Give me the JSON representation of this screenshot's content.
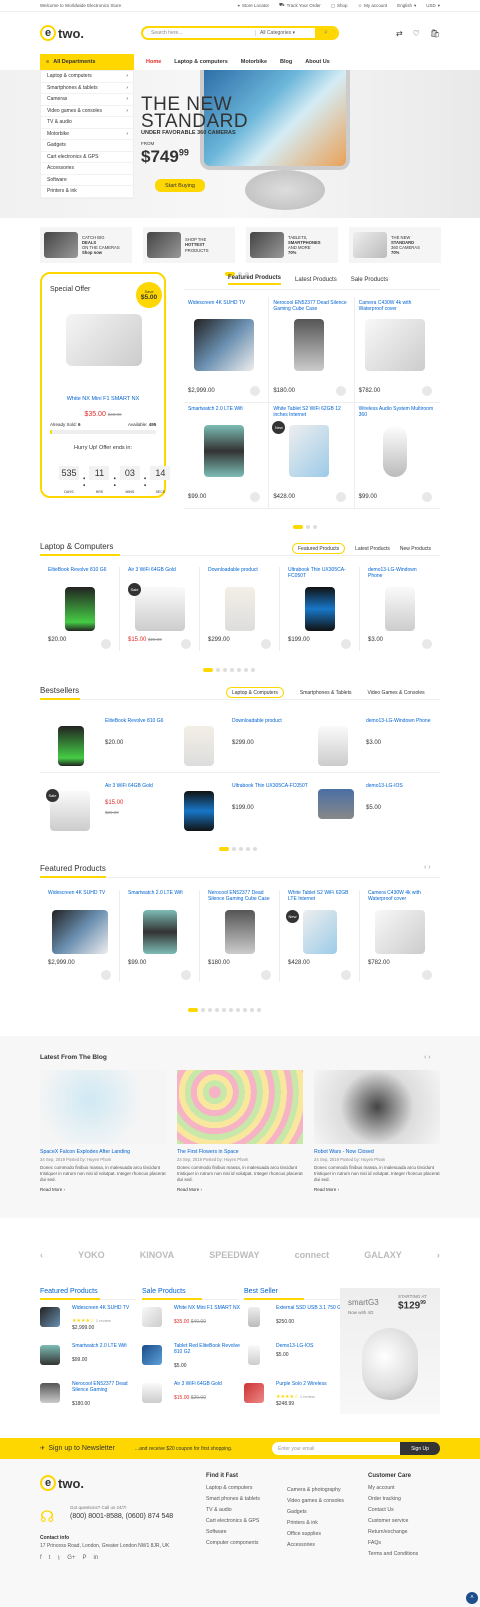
{
  "topbar": {
    "welcome": "Welcome to Worldwide Electronics Store",
    "links": [
      "Store Locator",
      "Track Your Order",
      "Shop",
      "My account"
    ],
    "lang": "English",
    "cur": "USD"
  },
  "header": {
    "logo": "two.",
    "search_placeholder": "Search here...",
    "search_cat": "All Categories"
  },
  "nav": {
    "dept": "All Departments",
    "links": [
      "Home",
      "Laptop & computers",
      "Motorbike",
      "Blog",
      "About Us"
    ]
  },
  "departments": [
    "Laptop & computers",
    "Smartphones & tablets",
    "Cameras",
    "Video games & consoles",
    "TV & audio",
    "Motorbike",
    "Gadgets",
    "Cart electronics & GPS",
    "Accessories",
    "Software",
    "Printers & ink"
  ],
  "hero": {
    "title1": "THE NEW",
    "title2": "STANDARD",
    "sub": "UNDER FAVORABLE 360 CAMERAS",
    "from": "FROM",
    "price": "$749",
    "cents": "99",
    "cta": "Start Buying"
  },
  "promos": [
    {
      "l1": "CATCH BIG",
      "l2": "DEALS",
      "l3": "ON THE CAMERAS",
      "shop": "Shop now"
    },
    {
      "l1": "SHOP THE",
      "l2": "HOTTEST",
      "l3": "PRODUCTS",
      "shop": ""
    },
    {
      "l1": "TABLETS,",
      "l2": "SMARTPHONES",
      "l3": "AND MORE",
      "shop": "70%"
    },
    {
      "l1": "THE NEW",
      "l2": "STANDARD",
      "l3": "360 CAMERAS",
      "shop": "70%"
    }
  ],
  "special": {
    "title": "Special Offer",
    "save": "Save",
    "amount": "$5.00",
    "name": "White NX Mini F1 SMART NX",
    "price": "$35.00",
    "old": "$40.00",
    "sold_label": "Already Sold:",
    "sold": "6",
    "avail_label": "Available:",
    "avail": "495",
    "hurry": "Hurry Up! Offer ends in:",
    "timer": [
      {
        "v": "535",
        "l": "DAYS"
      },
      {
        "v": "11",
        "l": "HRS"
      },
      {
        "v": "03",
        "l": "MINS"
      },
      {
        "v": "14",
        "l": "SECS"
      }
    ]
  },
  "featured_tabs": [
    "Featured Products",
    "Latest Products",
    "Sale Products"
  ],
  "featured": [
    {
      "name": "Widescreen 4K SUHD TV",
      "price": "$2,999.00"
    },
    {
      "name": "Nerocool EN52377 Dead Silence Gaming Cube Case",
      "price": "$180.00"
    },
    {
      "name": "Camera C430W 4k with Waterproof cover",
      "price": "$782.00"
    },
    {
      "name": "Smartwatch 2.0 LTE Wifi",
      "price": "$99.00"
    },
    {
      "name": "White Tablet S2 WiFi 62GB 12 inches Internet",
      "price": "$428.00",
      "badge": "New"
    },
    {
      "name": "Wireless Audio System Multiroom 360",
      "price": "$99.00"
    }
  ],
  "laptops": {
    "title": "Laptop & Computers",
    "tabs": [
      "Featured Products",
      "Latest Products",
      "New Products"
    ],
    "items": [
      {
        "name": "EliteBook Revolve 810 G6",
        "price": "$20.00"
      },
      {
        "name": "Air 3 WiFi 64GB Gold",
        "price": "$15.00",
        "old": "$20.00",
        "badge": "Sale"
      },
      {
        "name": "Downloadable product",
        "price": "$299.00"
      },
      {
        "name": "Ultrabook Thin UX305CA-FC050T",
        "price": "$199.00"
      },
      {
        "name": "demo13-LG-Windown Phone",
        "price": "$3.00"
      }
    ]
  },
  "bestsellers": {
    "title": "Bestsellers",
    "tabs": [
      "Laptop & Computers",
      "Smartphones & Tablets",
      "Video Games & Consoles"
    ],
    "items": [
      {
        "name": "EliteBook Revolve 810 G6",
        "price": "$20.00"
      },
      {
        "name": "Downloadable product",
        "price": "$299.00"
      },
      {
        "name": "demo13-LG-Windown Phone",
        "price": "$3.00"
      },
      {
        "name": "Air 3 WiFi 64GB Gold",
        "price": "$15.00",
        "old": "$20.00",
        "badge": "Sale"
      },
      {
        "name": "Ultrabook Thin UX305CA-FC050T",
        "price": "$199.00"
      },
      {
        "name": "demo13-LG-IOS",
        "price": "$5.00"
      }
    ]
  },
  "featured2": {
    "title": "Featured Products",
    "items": [
      {
        "name": "Widescreen 4K SUHD TV",
        "price": "$2,999.00"
      },
      {
        "name": "Smartwatch 2.0 LTE Wifi",
        "price": "$99.00"
      },
      {
        "name": "Nerocool EN52377 Dead Silence Gaming Cube Case",
        "price": "$180.00"
      },
      {
        "name": "White Tablet S2 WiFi 62GB LTE Internet",
        "price": "$428.00",
        "badge": "New"
      },
      {
        "name": "Camera C430W 4k with Waterproof cover",
        "price": "$782.00"
      }
    ]
  },
  "blog": {
    "title": "Latest From The Blog",
    "posts": [
      {
        "title": "SpaceX Falcon Explodes After Landing",
        "meta": "24 Sep, 2019   Posted by: Huyen Pham",
        "ex": "Donec commodo finibus massa, in malesuada arcu tincidunt tristique! in rutrum non nisi id volutpat. Integer rhoncus placerat dui sed.",
        "rm": "Read More"
      },
      {
        "title": "The First Flowers in Space",
        "meta": "24 Sep, 2019   Posted by: Huyen Pham",
        "ex": "Donec commodo finibus massa, in malesuada arcu tincidunt tristique! in rutrum non nisi id volutpat. Integer rhoncus placerat dui sed.",
        "rm": "Read More"
      },
      {
        "title": "Robot Wars - Now Closed",
        "meta": "24 Sep, 2019   Posted by: Huyen Pham",
        "ex": "Donec commodo finibus massa, in malesuada arcu tincidunt tristique! in rutrum non nisi id volutpat. Integer rhoncus placerat dui sed.",
        "rm": "Read More"
      }
    ]
  },
  "brands": [
    "YOKO",
    "KINOVA",
    "SPEEDWAY",
    "connect",
    "GALAXY"
  ],
  "mini": [
    {
      "title": "Featured Products",
      "items": [
        {
          "name": "Widescreen 4K SUHD TV",
          "rev": "1 review",
          "price": "$2,999.00"
        },
        {
          "name": "Smartwatch 2.0 LTE Wifi",
          "price": "$99.00"
        },
        {
          "name": "Nerocool EN52377 Dead Silence Gaming",
          "price": "$180.00"
        }
      ]
    },
    {
      "title": "Sale Products",
      "items": [
        {
          "name": "White NX Mini F1 SMART NX",
          "price": "$35.00",
          "old": "$40.00"
        },
        {
          "name": "Tablet Red EliteBook Revolve 810 G2",
          "price": "$5.00"
        },
        {
          "name": "Air 3 WiFi 64GB Gold",
          "price": "$15.00",
          "old": "$20.00"
        }
      ]
    },
    {
      "title": "Best Seller",
      "items": [
        {
          "name": "External SSD USB 3.1 750 GB",
          "price": "$250.00"
        },
        {
          "name": "Demo13-LG-IOS",
          "price": "$5.00"
        },
        {
          "name": "Purple Solo 2 Wireless",
          "rev": "1 review",
          "price": "$248.99"
        }
      ]
    }
  ],
  "ad": {
    "brand": "smartG3",
    "line": "Now with 4G",
    "starting": "STARTING AT",
    "price": "$129",
    "cents": "99"
  },
  "newsletter": {
    "label": "Sign up to Newsletter",
    "offer": "...and receive $20 coupon for first shopping.",
    "placeholder": "Enter your email",
    "btn": "Sign Up"
  },
  "footer": {
    "question": "Got questions? Call us 24/7!",
    "phone": "(800) 8001-8588, (0600) 874 548",
    "contact_h": "Contact info",
    "address": "17 Princess Road, London, Greater London NW1 8JR, UK",
    "find_h": "Find it Fast",
    "find": [
      "Laptop & computers",
      "Smart phones & tablets",
      "TV & audio",
      "Cart electronics & GPS",
      "Software",
      "Computer components"
    ],
    "find2": [
      "Camera & photography",
      "Video games & consoles",
      "Gadgets",
      "Printers & ink",
      "Office supplies",
      "Accessories"
    ],
    "care_h": "Customer Care",
    "care": [
      "My account",
      "Order tracking",
      "Contact Us",
      "Customer service",
      "Return/exchange",
      "FAQs",
      "Terms and Conditions"
    ]
  },
  "colors": {
    "accent": "#fed700",
    "link": "#0063d1",
    "sale": "#e02b27"
  }
}
